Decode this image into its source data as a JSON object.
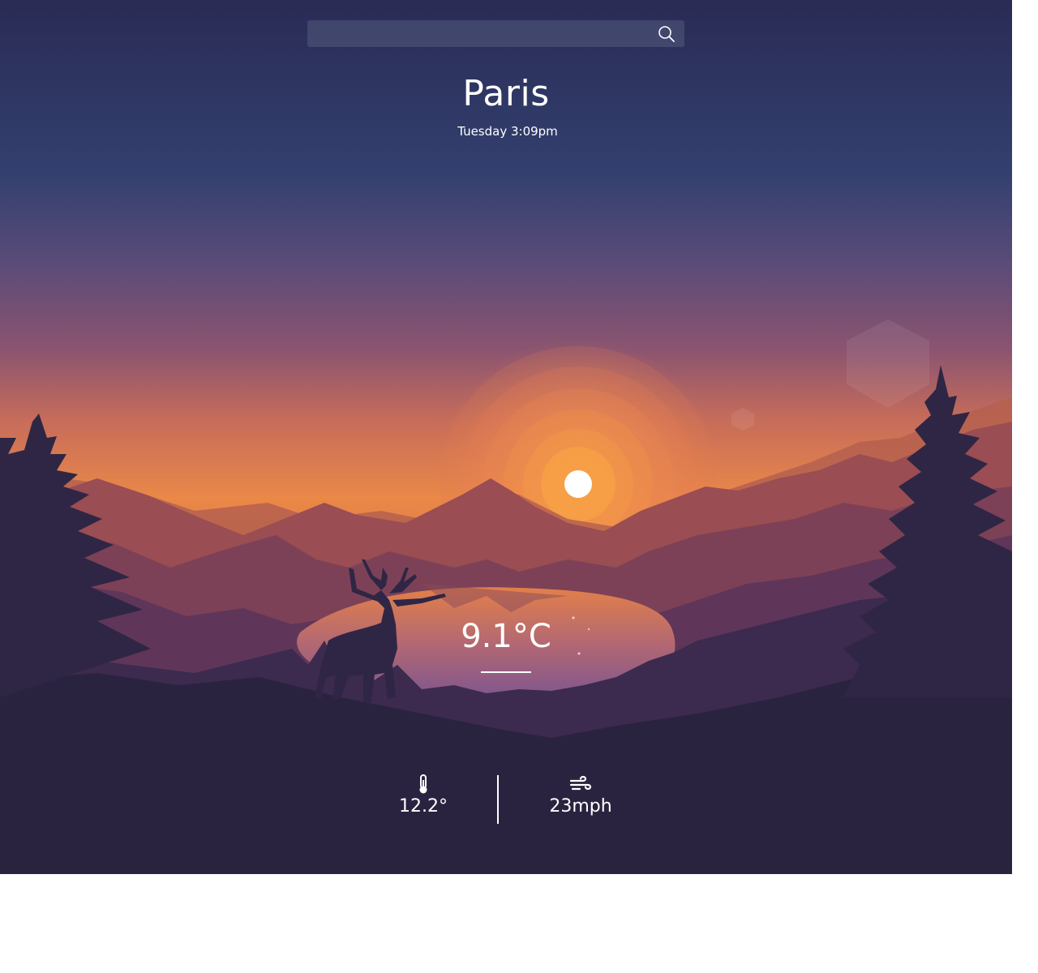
{
  "search": {
    "value": "",
    "icon": "search-icon"
  },
  "location": {
    "city": "Paris",
    "datetime": "Tuesday 3:09pm"
  },
  "current": {
    "temperature": "9.1°C"
  },
  "details": {
    "feels_like": {
      "icon": "thermometer-icon",
      "value": "12.2°"
    },
    "wind": {
      "icon": "wind-icon",
      "value": "23mph"
    }
  },
  "colors": {
    "sky_top": "#2c2c58",
    "sky_mid": "#5f4a78",
    "sky_horizon": "#e8833f",
    "sun": "#ffffff",
    "ground": "#2a2340",
    "text": "#ffffff"
  }
}
